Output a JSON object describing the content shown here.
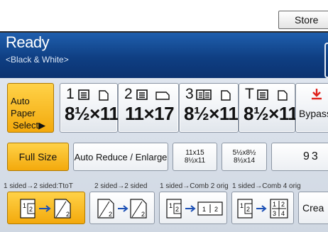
{
  "toolbar": {
    "store_label": "Store"
  },
  "header": {
    "status": "Ready",
    "mode": "<Black & White>"
  },
  "paper": {
    "auto_line1": "Auto Paper",
    "auto_line2": "Select▶",
    "trays": [
      {
        "tray": "1",
        "size": "8½×11"
      },
      {
        "tray": "2",
        "size": "11×17"
      },
      {
        "tray": "3",
        "size": "8½×11"
      },
      {
        "tray": "T",
        "size": "8½×11"
      }
    ],
    "bypass_label": "Bypass"
  },
  "reduce": {
    "full_size": "Full Size",
    "auto_reduce": "Auto Reduce / Enlarge",
    "preset1_top": "11x15",
    "preset1_bottom": "8½x11",
    "preset2_top": "5½x8½",
    "preset2_bottom": "8½x14",
    "percent": "93"
  },
  "duplex": {
    "labels": [
      "1 sided→2 sided:TtoT",
      "2 sided→2 sided",
      "1 sided→Comb 2 orig",
      "1 sided→Comb 4 orig"
    ],
    "create_label": "Crea"
  },
  "colors": {
    "header_blue": "#0f3f83",
    "selected_orange": "#f3a90c",
    "bypass_red": "#e0211a"
  }
}
